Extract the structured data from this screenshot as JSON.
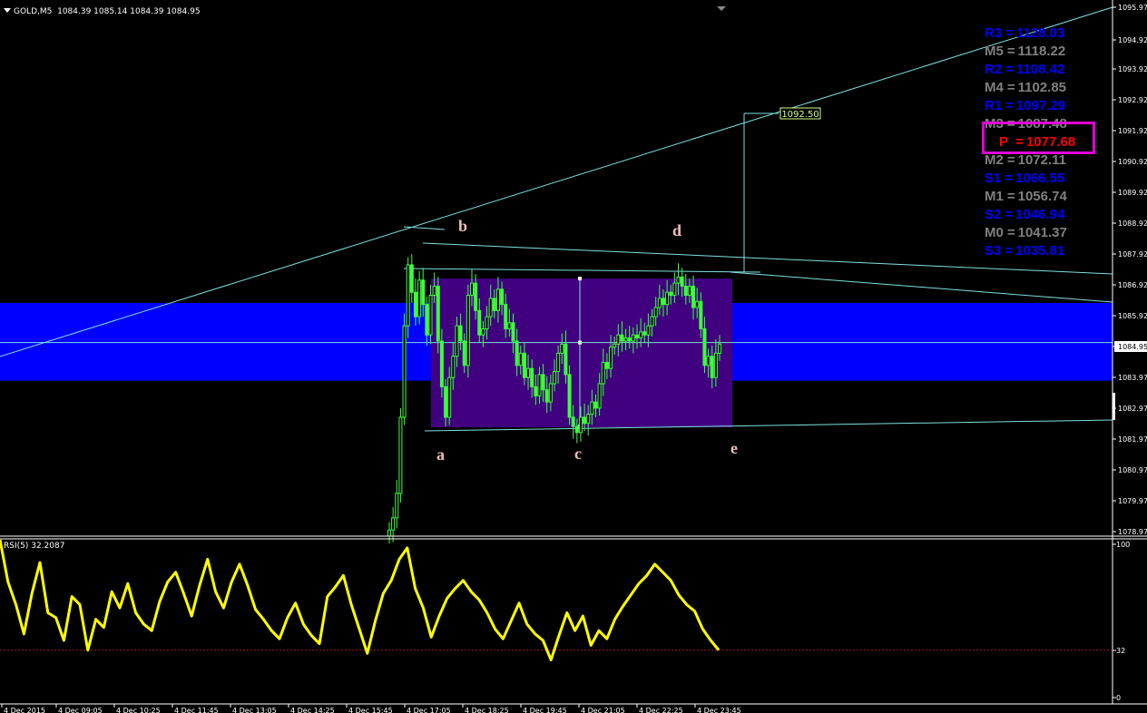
{
  "header": {
    "symbol_timeframe": "GOLD,M5",
    "ohlc": "1084.39 1085.14 1084.39 1084.95"
  },
  "rsi_header": "RSI(5) 32.2087",
  "price_axis": {
    "ticks": [
      "1095.97",
      "1094.92",
      "1093.92",
      "1092.92",
      "1091.92",
      "1090.92",
      "1089.92",
      "1088.92",
      "1087.92",
      "1086.92",
      "1085.92",
      "1084.95",
      "1083.97",
      "1082.97",
      "1081.97",
      "1080.97",
      "1079.97",
      "1078.97"
    ],
    "current_price": "1084.95"
  },
  "rsi_axis": {
    "ticks": [
      "100",
      "32",
      "0"
    ]
  },
  "time_axis": {
    "labels": [
      "4 Dec 2015",
      "4 Dec 09:05",
      "4 Dec 10:25",
      "4 Dec 11:45",
      "4 Dec 13:05",
      "4 Dec 14:25",
      "4 Dec 15:45",
      "4 Dec 17:05",
      "4 Dec 18:25",
      "4 Dec 19:45",
      "4 Dec 21:05",
      "4 Dec 22:25",
      "4 Dec 23:45"
    ]
  },
  "pivots": [
    {
      "key": "R3",
      "value": "1128.03",
      "color": "#0000ff"
    },
    {
      "key": "M5",
      "value": "1118.22",
      "color": "#808080"
    },
    {
      "key": "R2",
      "value": "1108.42",
      "color": "#0000ff"
    },
    {
      "key": "M4",
      "value": "1102.85",
      "color": "#808080"
    },
    {
      "key": "R1",
      "value": "1097.29",
      "color": "#0000ff"
    },
    {
      "key": "M3",
      "value": "1087.48",
      "color": "#808080"
    },
    {
      "key": "P",
      "value": "1077.68",
      "color": "#ff0000"
    },
    {
      "key": "M2",
      "value": "1072.11",
      "color": "#808080"
    },
    {
      "key": "S1",
      "value": "1066.55",
      "color": "#0000ff"
    },
    {
      "key": "M1",
      "value": "1056.74",
      "color": "#808080"
    },
    {
      "key": "S2",
      "value": "1046.94",
      "color": "#0000ff"
    },
    {
      "key": "M0",
      "value": "1041.37",
      "color": "#808080"
    },
    {
      "key": "S3",
      "value": "1035.81",
      "color": "#0000ff"
    }
  ],
  "wave_labels": [
    "a",
    "b",
    "c",
    "d",
    "e"
  ],
  "target_label": "1092.50",
  "colors": {
    "background": "#000000",
    "candles": "#3cff3c",
    "trendlines": "#7fe0e0",
    "zone": "#0000ff",
    "rectangle": "#400080",
    "rsi_line": "#ffff00",
    "pivot_highlight": "#e000d8"
  },
  "chart_data": [
    {
      "type": "candlestick",
      "title": "GOLD,M5",
      "ylim": [
        1078.6,
        1096.1
      ],
      "close_series": [
        1078.8,
        1079.2,
        1080.0,
        1082.5,
        1085.5,
        1087.5,
        1086.6,
        1085.8,
        1087.0,
        1086.2,
        1085.2,
        1086.5,
        1086.8,
        1085.0,
        1083.5,
        1082.5,
        1083.8,
        1084.5,
        1085.5,
        1085.0,
        1084.2,
        1086.5,
        1086.9,
        1086.0,
        1085.2,
        1085.4,
        1085.8,
        1086.4,
        1086.0,
        1086.7,
        1086.2,
        1085.4,
        1085.6,
        1085.0,
        1084.2,
        1084.6,
        1083.8,
        1084.1,
        1083.5,
        1083.2,
        1083.9,
        1083.4,
        1083.0,
        1083.6,
        1084.0,
        1084.6,
        1084.9,
        1083.9,
        1082.5,
        1082.2,
        1082.0,
        1082.5,
        1082.3,
        1082.6,
        1083.0,
        1082.8,
        1083.6,
        1084.3,
        1084.1,
        1084.8,
        1084.9,
        1085.2,
        1085.0,
        1085.1,
        1085.0,
        1085.2,
        1085.1,
        1085.3,
        1085.2,
        1085.5,
        1085.8,
        1086.1,
        1086.4,
        1086.2,
        1086.6,
        1086.5,
        1086.9,
        1087.1,
        1086.8,
        1086.5,
        1086.8,
        1086.1,
        1086.3,
        1085.4,
        1084.2,
        1084.5,
        1083.8,
        1084.6,
        1084.9
      ],
      "price_lines": [
        {
          "label": "current",
          "value": 1084.95
        }
      ]
    },
    {
      "type": "line",
      "title": "RSI(5) 32.2087",
      "ylim": [
        0,
        100
      ],
      "levels": [
        32
      ],
      "series": [
        {
          "values": [
            100,
            74,
            60,
            42,
            67,
            86,
            55,
            52,
            38,
            65,
            60,
            32,
            51,
            46,
            68,
            58,
            73,
            55,
            48,
            44,
            62,
            74,
            80,
            67,
            53,
            72,
            88,
            68,
            58,
            74,
            85,
            72,
            57,
            51,
            44,
            39,
            52,
            61,
            48,
            41,
            36,
            65,
            71,
            78,
            60,
            45,
            30,
            50,
            67,
            75,
            88,
            95,
            70,
            58,
            40,
            53,
            64,
            70,
            75,
            68,
            63,
            55,
            45,
            39,
            50,
            61,
            48,
            42,
            38,
            26,
            41,
            55,
            44,
            53,
            35,
            44,
            39,
            51,
            59,
            66,
            73,
            78,
            85,
            80,
            75,
            66,
            60,
            56,
            45,
            38,
            32
          ]
        }
      ]
    }
  ]
}
